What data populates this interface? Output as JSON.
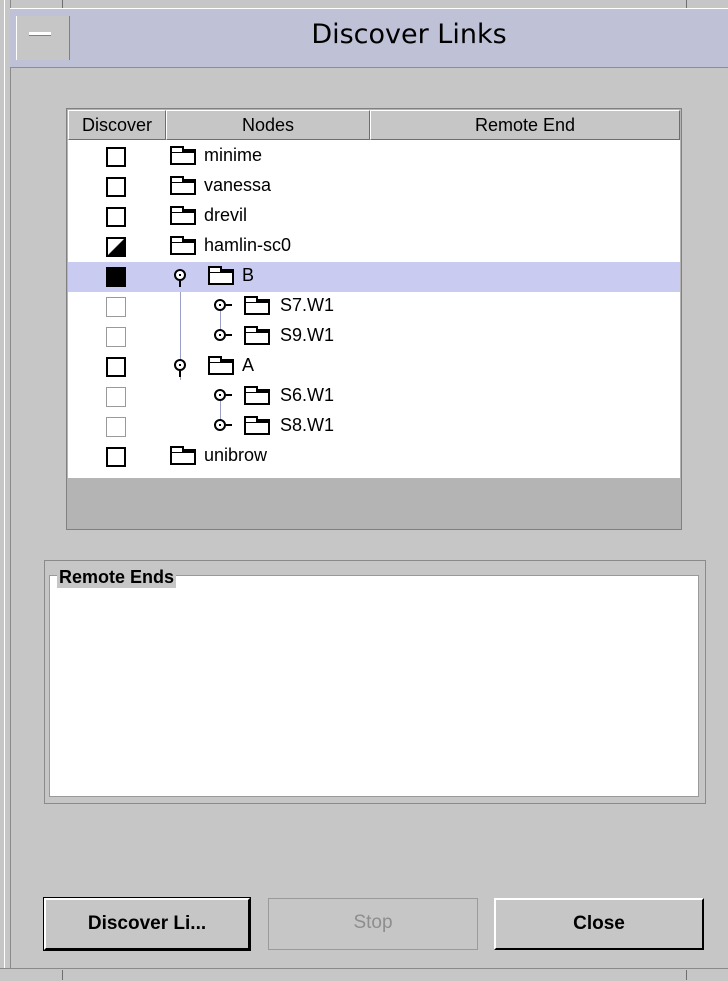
{
  "window": {
    "title": "Discover Links"
  },
  "table": {
    "columns": [
      "Discover",
      "Nodes",
      "Remote End"
    ],
    "rows": [
      {
        "label": "minime",
        "check": "unchecked",
        "enabled": true,
        "selected": false
      },
      {
        "label": "vanessa",
        "check": "unchecked",
        "enabled": true,
        "selected": false
      },
      {
        "label": "drevil",
        "check": "unchecked",
        "enabled": true,
        "selected": false
      },
      {
        "label": "hamlin-sc0",
        "check": "partial",
        "enabled": true,
        "selected": false
      },
      {
        "label": "B",
        "check": "checked",
        "enabled": true,
        "selected": true
      },
      {
        "label": "S7.W1",
        "check": "unchecked",
        "enabled": false,
        "selected": false
      },
      {
        "label": "S9.W1",
        "check": "unchecked",
        "enabled": false,
        "selected": false
      },
      {
        "label": "A",
        "check": "unchecked",
        "enabled": true,
        "selected": false
      },
      {
        "label": "S6.W1",
        "check": "unchecked",
        "enabled": false,
        "selected": false
      },
      {
        "label": "S8.W1",
        "check": "unchecked",
        "enabled": false,
        "selected": false
      },
      {
        "label": "unibrow",
        "check": "unchecked",
        "enabled": true,
        "selected": false
      }
    ]
  },
  "remote_ends": {
    "title": "Remote Ends"
  },
  "buttons": {
    "discover": "Discover Li...",
    "stop": "Stop",
    "close": "Close"
  },
  "colors": {
    "background": "#c6c6c6",
    "titlebar": "#bfc2d6",
    "selection": "#c9cbf0"
  }
}
